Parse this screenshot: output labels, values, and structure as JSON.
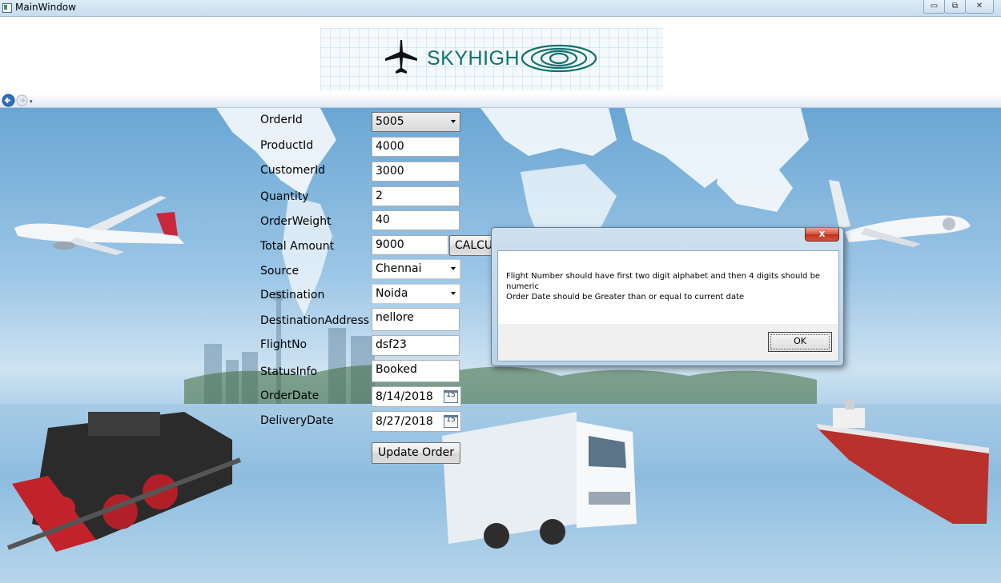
{
  "window": {
    "title": "MainWindow",
    "minimize_glyph": "▭",
    "restore_glyph": "⧉",
    "close_glyph": "✕"
  },
  "header": {
    "logo_text": "SKYHIGH"
  },
  "nav": {
    "dropdown_glyph": "▾"
  },
  "form": {
    "labels": {
      "order_id": "OrderId",
      "product_id": "ProductId",
      "customer_id": "CustomerId",
      "quantity": "Quantity",
      "order_weight": "OrderWeight",
      "total_amount": "Total Amount",
      "source": "Source",
      "destination": "Destination",
      "destination_address": "DestinationAddress",
      "flight_no": "FlightNo",
      "status_info": "StatusInfo",
      "order_date": "OrderDate",
      "delivery_date": "DeliveryDate"
    },
    "values": {
      "order_id": "5005",
      "product_id": "4000",
      "customer_id": "3000",
      "quantity": "2",
      "order_weight": "40",
      "total_amount": "9000",
      "source": "Chennai",
      "destination": "Noida",
      "destination_address": "nellore",
      "flight_no": "dsf23",
      "status_info": "Booked",
      "order_date": "8/14/2018",
      "delivery_date": "8/27/2018"
    },
    "calendar_day": "15",
    "calculate_label": "CALCU",
    "update_label": "Update Order"
  },
  "dialog": {
    "close_glyph": "x",
    "message_line1": "Flight Number should have first two digit alphabet and then 4 digits should be numeric",
    "message_line2": "Order Date should be Greater than or equal to current date",
    "ok_label": "OK"
  }
}
